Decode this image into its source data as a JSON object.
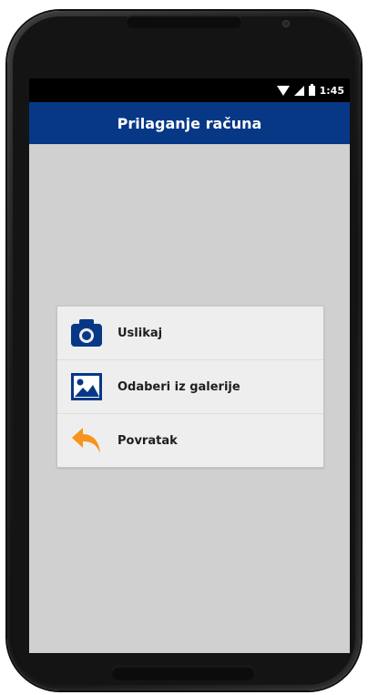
{
  "status_bar": {
    "time": "1:45",
    "icons": [
      "wifi-icon",
      "signal-icon",
      "battery-icon"
    ]
  },
  "app_bar": {
    "title": "Prilaganje računa",
    "background_color": "#063886"
  },
  "menu": {
    "items": [
      {
        "label": "Uslikaj",
        "icon": "camera-icon",
        "icon_color": "#063886"
      },
      {
        "label": "Odaberi iz galerije",
        "icon": "image-gallery-icon",
        "icon_color": "#063886"
      },
      {
        "label": "Povratak",
        "icon": "back-arrow-icon",
        "icon_color": "#f7941d"
      }
    ]
  },
  "colors": {
    "screen_background": "#d0d0d0",
    "card_background": "#eeeeee"
  }
}
